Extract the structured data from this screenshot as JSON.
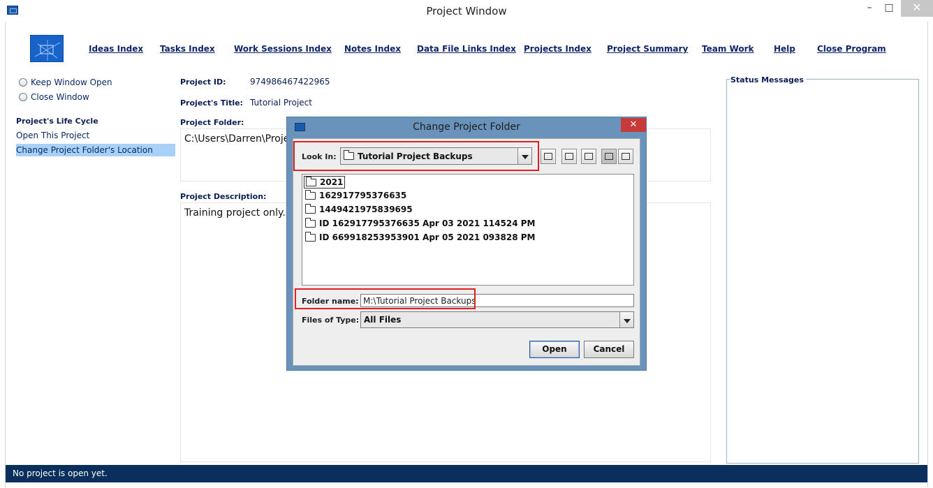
{
  "window": {
    "title": "Project Window",
    "minimize": "–",
    "maximize": "□",
    "close": "✕"
  },
  "toolbar": {
    "items": [
      "Ideas Index",
      "Tasks Index",
      "Work Sessions Index",
      "Notes Index",
      "Data File Links Index",
      "Projects Index",
      "Project Summary",
      "Team Work",
      "Help",
      "Close Program"
    ]
  },
  "left_panel": {
    "keep_open": "Keep Window Open",
    "close_window": "Close Window",
    "section_title": "Project's Life Cycle",
    "open_project": "Open This Project",
    "change_folder": "Change Project Folder's Location"
  },
  "project": {
    "id_label": "Project ID:",
    "id_value": "974986467422965",
    "title_label": "Project's Title:",
    "title_value": "Tutorial Project",
    "folder_label": "Project Folder:",
    "folder_value": "C:\\Users\\Darren\\Projec",
    "desc_label": "Project Description:",
    "desc_value": "Training project only."
  },
  "status": {
    "title": "Status Messages",
    "bar_text": "No project is open yet."
  },
  "dialog": {
    "title": "Change Project Folder",
    "close": "✕",
    "look_in_label": "Look In:",
    "look_in_value": "Tutorial Project Backups",
    "files": [
      "2021",
      "162917795376635",
      "1449421975839695",
      "ID 162917795376635 Apr 03 2021 114524 PM",
      "ID 669918253953901 Apr 05 2021 093828 PM"
    ],
    "folder_name_label": "Folder name:",
    "folder_name_value": "M:\\Tutorial Project Backups",
    "file_type_label": "Files of Type:",
    "file_type_value": "All Files",
    "open_button": "Open",
    "cancel_button": "Cancel"
  },
  "colors": {
    "accent": "#0b2f5c",
    "highlight": "#e02020",
    "selection": "#a8d0f8"
  }
}
